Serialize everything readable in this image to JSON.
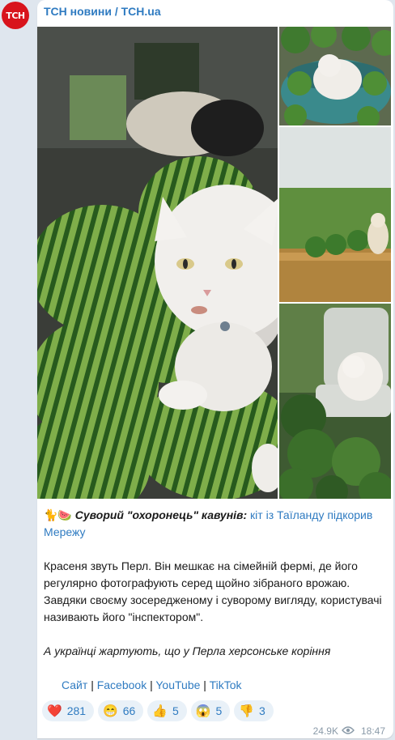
{
  "channel": {
    "name": "ТСН новини / TCH.ua",
    "avatar_text": "ТСН"
  },
  "post": {
    "title_emoji": "🐈🍉",
    "title_bold": "Суворий \"охоронець\" кавунів:",
    "title_link": "кіт із Таїланду підкорив Мережу",
    "paragraph1": "Красеня звуть Перл. Він мешкає на сімейній фермі, де його регулярно фотографують серед щойно зібраного врожаю. Завдяки своєму зосередженому і суворому вигляду, користувачі називають його \"інспектором\".",
    "paragraph2": "А українці жартують, що у Перла херсонське коріння",
    "links": [
      {
        "label": "Сайт"
      },
      {
        "label": "Facebook"
      },
      {
        "label": "YouTube"
      },
      {
        "label": "TikTok"
      }
    ],
    "link_separator": "|"
  },
  "reactions": [
    {
      "emoji": "❤️",
      "icon": "red-heart-icon",
      "count": "281"
    },
    {
      "emoji": "😁",
      "icon": "grin-face-icon",
      "count": "66"
    },
    {
      "emoji": "👍",
      "icon": "thumbs-up-icon",
      "count": "5"
    },
    {
      "emoji": "😱",
      "icon": "screaming-face-icon",
      "count": "5"
    },
    {
      "emoji": "👎",
      "icon": "thumbs-down-icon",
      "count": "3"
    }
  ],
  "meta": {
    "views": "24.9K",
    "time": "18:47"
  },
  "colors": {
    "accent": "#2f7bc1",
    "avatar_bg": "#d8141c",
    "background": "#dfe6ee"
  }
}
